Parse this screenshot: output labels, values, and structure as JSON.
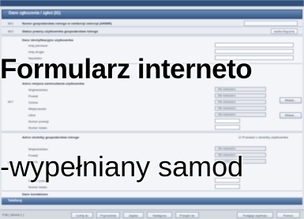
{
  "window": {
    "title": "Dane zgłoszenia / zgłoś (IG)"
  },
  "header": {
    "title": "Dane zgłoszenia / zgłoś (IG)"
  },
  "rows": [
    {
      "code": "B01",
      "label": "Numer gospodarstwa rolnego w ewidencji zwierząt (ARiMR)",
      "value": ""
    },
    {
      "code": "B02",
      "label": "Status prawny użytkownika gospodarstwa rolnego",
      "value": "osoba fizyczna"
    }
  ],
  "owner_section": {
    "title": "Dane identyfikacyjne użytkownika",
    "fields": [
      {
        "label": "Imię pierwsze",
        "value": ""
      },
      {
        "label": "Imię drugie",
        "value": ""
      },
      {
        "label": "Nazwisko",
        "value": ""
      }
    ]
  },
  "address_section": {
    "code": "B07",
    "title": "Adres miejsca zamieszkania użytkownika",
    "fields": [
      {
        "label": "Województwo",
        "value": "Nie wskazano"
      },
      {
        "label": "Powiat",
        "value": "Nie wskazano"
      },
      {
        "label": "Gmina",
        "value": "Nie wskazano"
      },
      {
        "label": "Miejscowość",
        "value": "Nie wskazano"
      },
      {
        "label": "Ulica",
        "value": "Nie wskazano"
      },
      {
        "label": "Numer posesji",
        "value": ""
      },
      {
        "label": "Numer lokalu",
        "value": ""
      }
    ],
    "buttons": [
      "Wskaż...",
      "Wskaż..."
    ]
  },
  "farm_section": {
    "code": "B08",
    "title": "Adres siedziby gospodarstwa rolnego",
    "checkbox_label": "Prowadzi z siedziby użytkownika",
    "fields": [
      {
        "label": "Województwo",
        "value": "Nie wskazano"
      },
      {
        "label": "Powiat",
        "value": "Nie wskazano"
      },
      {
        "label": "Gmina",
        "value": "Nie wskazano"
      },
      {
        "label": "Numer posesji",
        "value": ""
      },
      {
        "label": "Numer lokalu",
        "value": ""
      }
    ]
  },
  "contact_section": {
    "title": "Dane kontaktowe",
    "bar": "Telefony"
  },
  "statusbar": {
    "left": "F18 ( strona 1 )",
    "buttons": [
      "Cofnij do",
      "Poprzednia",
      "Zapisz",
      "Następna",
      "Przejdź do",
      "Podgląd wydruku",
      "Pomoc"
    ],
    "right": ""
  },
  "overlay": {
    "line1": "Formularz interneto",
    "line2": "-wypełniany samod"
  }
}
